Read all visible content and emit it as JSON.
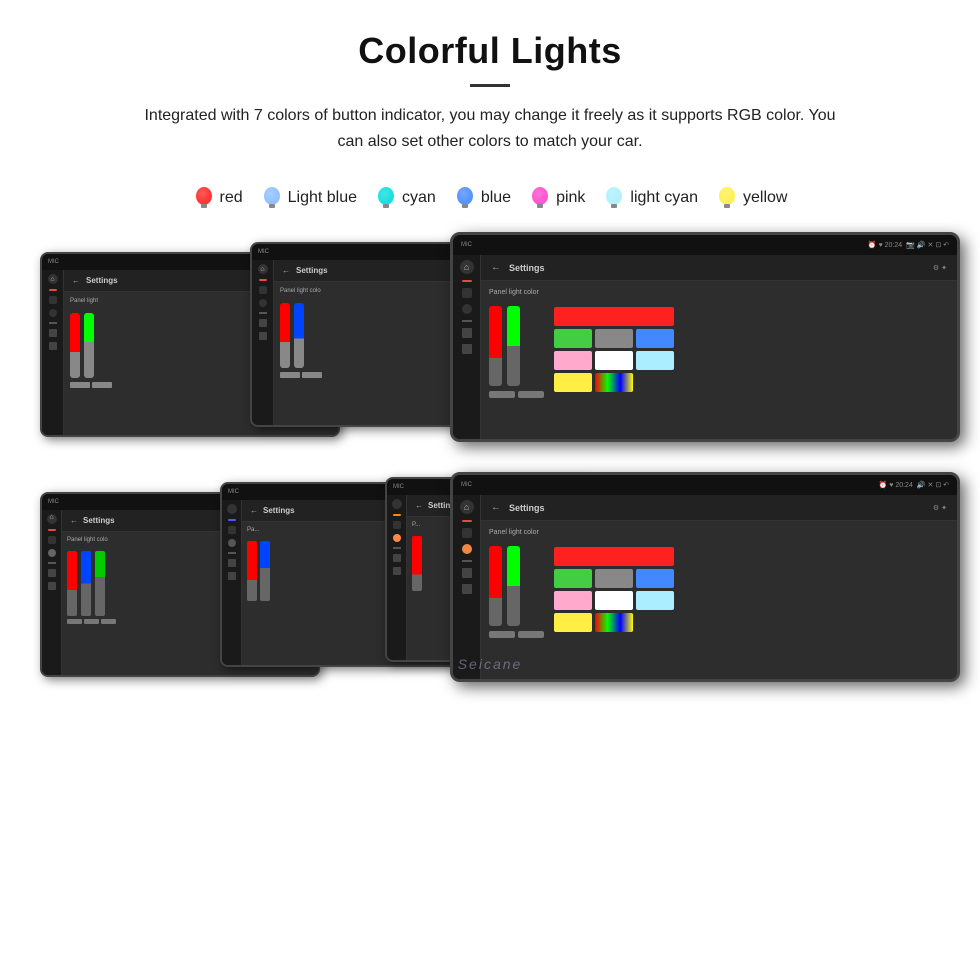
{
  "header": {
    "title": "Colorful Lights",
    "description": "Integrated with 7 colors of button indicator, you may change it freely as it supports RGB color. You can also set other colors to match your car."
  },
  "colors": [
    {
      "name": "red",
      "color": "#ff2020",
      "label": "red"
    },
    {
      "name": "light-blue",
      "color": "#88bbff",
      "label": "Light blue"
    },
    {
      "name": "cyan",
      "color": "#00dddd",
      "label": "cyan"
    },
    {
      "name": "blue",
      "color": "#4488ff",
      "label": "blue"
    },
    {
      "name": "pink",
      "color": "#ff44cc",
      "label": "pink"
    },
    {
      "name": "light-cyan",
      "color": "#aaeeff",
      "label": "light cyan"
    },
    {
      "name": "yellow",
      "color": "#ffee44",
      "label": "yellow"
    }
  ],
  "watermark": "Seicane",
  "screens": {
    "nav_title": "Settings",
    "panel_label": "Panel light color",
    "back_arrow": "←"
  }
}
